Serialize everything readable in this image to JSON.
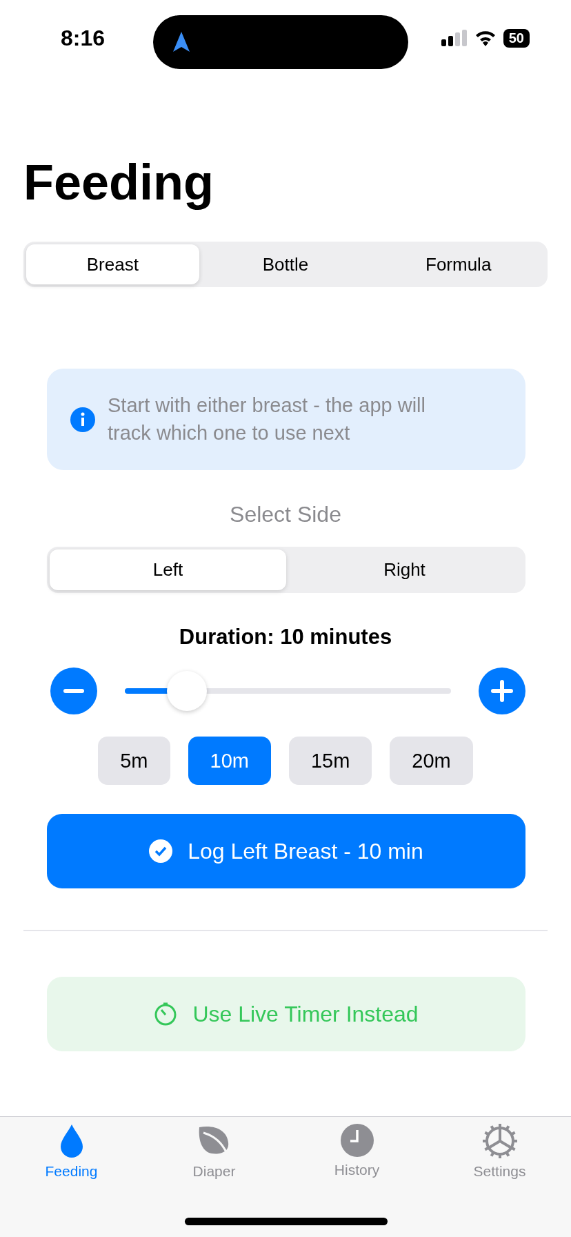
{
  "status_bar": {
    "time": "8:16",
    "battery": "50"
  },
  "title": "Feeding",
  "feeding_tabs": [
    {
      "label": "Breast",
      "selected": true
    },
    {
      "label": "Bottle",
      "selected": false
    },
    {
      "label": "Formula",
      "selected": false
    }
  ],
  "info": {
    "text": "Start with either breast - the app will track which one to use next"
  },
  "side_label": "Select Side",
  "sides": [
    {
      "label": "Left",
      "selected": true
    },
    {
      "label": "Right",
      "selected": false
    }
  ],
  "duration": {
    "label": "Duration: 10 minutes",
    "level": 0.19
  },
  "presets": [
    {
      "label": "5m",
      "selected": false
    },
    {
      "label": "10m",
      "selected": true
    },
    {
      "label": "15m",
      "selected": false
    },
    {
      "label": "20m",
      "selected": false
    }
  ],
  "log_button": "Log Left Breast - 10 min",
  "timer_button": "Use Live Timer Instead",
  "tab_bar": [
    {
      "label": "Feeding",
      "kind": "drop",
      "selected": true
    },
    {
      "label": "Diaper",
      "kind": "leaf",
      "selected": false
    },
    {
      "label": "History",
      "kind": "clock",
      "selected": false
    },
    {
      "label": "Settings",
      "kind": "gear",
      "selected": false
    }
  ]
}
